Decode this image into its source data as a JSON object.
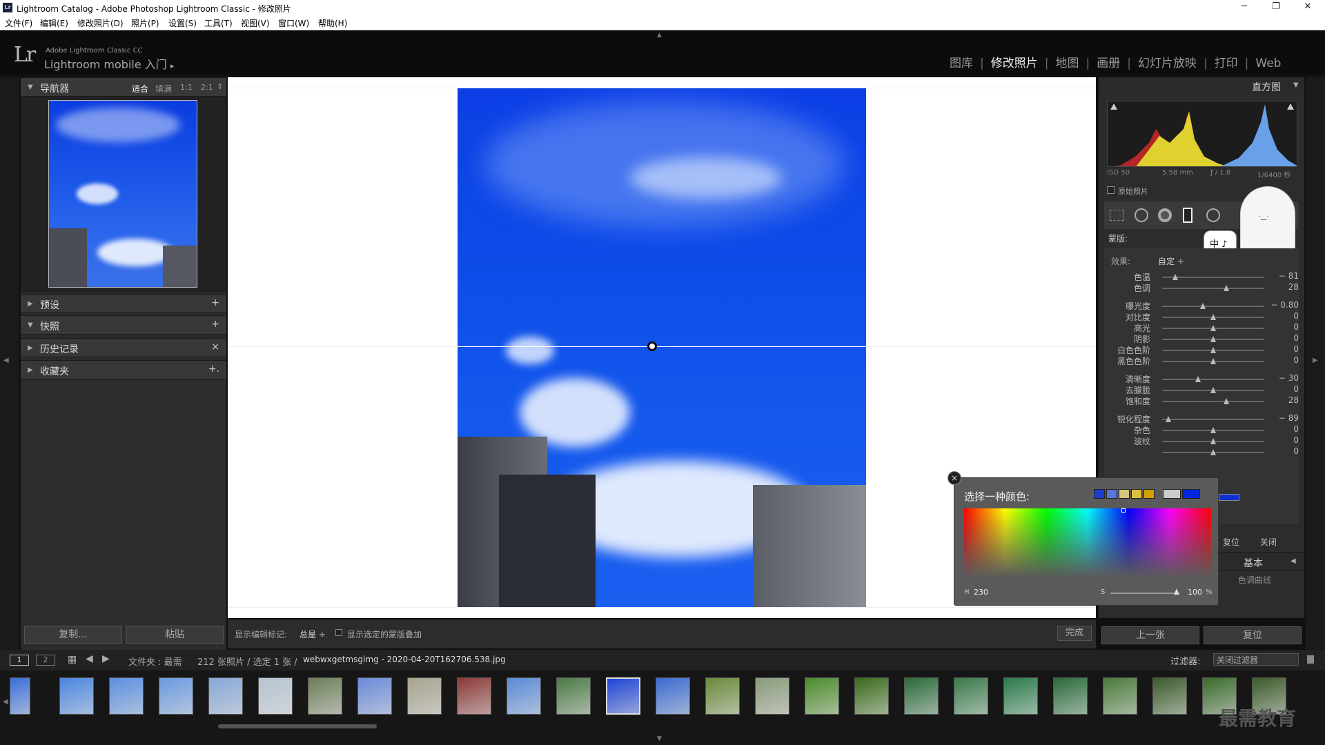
{
  "window": {
    "title": "Lightroom Catalog - Adobe Photoshop Lightroom Classic - 修改照片",
    "app_icon": "Lr",
    "minimize": "─",
    "maximize": "❐",
    "close": "✕"
  },
  "menu": [
    "文件(F)",
    "编辑(E)",
    "修改照片(D)",
    "照片(P)",
    "设置(S)",
    "工具(T)",
    "视图(V)",
    "窗口(W)",
    "帮助(H)"
  ],
  "identity": {
    "logo": "Lr",
    "small": "Adobe Lightroom Classic CC",
    "big": "Lightroom mobile 入门",
    "arrow": "▸"
  },
  "modules": [
    {
      "label": "图库",
      "active": false
    },
    {
      "label": "修改照片",
      "active": true
    },
    {
      "label": "地图",
      "active": false
    },
    {
      "label": "画册",
      "active": false
    },
    {
      "label": "幻灯片放映",
      "active": false
    },
    {
      "label": "打印",
      "active": false
    },
    {
      "label": "Web",
      "active": false
    }
  ],
  "navigator": {
    "title": "导航器",
    "fit": "适合",
    "fill": "填满",
    "one": "1:1",
    "two": "2:1",
    "arrows": "⇕"
  },
  "left_panels": [
    {
      "label": "预设",
      "end": "+",
      "expanded": false
    },
    {
      "label": "快照",
      "end": "+",
      "expanded": true
    },
    {
      "label": "历史记录",
      "end": "×",
      "expanded": false
    },
    {
      "label": "收藏夹",
      "end": "+.",
      "expanded": false
    }
  ],
  "left_buttons": {
    "copy": "复制...",
    "paste": "粘贴"
  },
  "histogram": {
    "title": "直方图",
    "iso": "ISO 50",
    "focal": "5.58 mm",
    "aperture": "ƒ / 1.8",
    "shutter": "1/6400 秒",
    "original": "原始照片"
  },
  "mask": {
    "label": "蒙版:",
    "effect_label": "效果:",
    "effect_value": "自定 ÷"
  },
  "sliders": [
    {
      "name": "色温",
      "value": "− 81",
      "pos": 0.13
    },
    {
      "name": "色调",
      "value": "28",
      "pos": 0.63
    },
    {
      "name": "曝光度",
      "value": "− 0.80",
      "pos": 0.4
    },
    {
      "name": "对比度",
      "value": "0",
      "pos": 0.5
    },
    {
      "name": "高光",
      "value": "0",
      "pos": 0.5
    },
    {
      "name": "阴影",
      "value": "0",
      "pos": 0.5
    },
    {
      "name": "白色色阶",
      "value": "0",
      "pos": 0.5
    },
    {
      "name": "黑色色阶",
      "value": "0",
      "pos": 0.5
    },
    {
      "name": "清晰度",
      "value": "− 30",
      "pos": 0.35
    },
    {
      "name": "去朦胧",
      "value": "0",
      "pos": 0.5
    },
    {
      "name": "饱和度",
      "value": "28",
      "pos": 0.63
    },
    {
      "name": "锐化程度",
      "value": "− 89",
      "pos": 0.06
    },
    {
      "name": "杂色",
      "value": "0",
      "pos": 0.5
    },
    {
      "name": "波纹",
      "value": "0",
      "pos": 0.5
    },
    {
      "name": "",
      "value": "0",
      "pos": 0.5
    }
  ],
  "color_picker": {
    "title": "选择一种颜色:",
    "h_label": "H",
    "h_value": "230",
    "s_label": "S",
    "s_value": "100",
    "percent": "%",
    "close": "×",
    "swatches": [
      "#1a3fd0",
      "#5a76d8",
      "#d8c77a",
      "#e0c040",
      "#d4a000"
    ],
    "big_swatches": [
      "#cccccc",
      "#0026e0"
    ]
  },
  "right_bottom": {
    "reset": "复位",
    "close": "关闭",
    "basic": "基本",
    "tone_curve": "色调曲线",
    "prev": "上一张",
    "reset_btn": "复位"
  },
  "toolbar": {
    "show_edit": "显示编辑标记:",
    "always": "总是 ÷",
    "overlay": "显示选定的蒙版叠加",
    "done": "完成"
  },
  "filmstrip_bar": {
    "p1": "1",
    "p2": "2",
    "folder": "文件夹 : 最需",
    "count": "212 张照片 / 选定 1 张 /",
    "filename": "webwxgetmsgimg - 2020-04-20T162706.538.jpg",
    "filter_label": "过滤器:",
    "filter_value": "关闭过滤器"
  },
  "watermark": "最需教育",
  "popup_cat": {
    "text": "中 ♪"
  },
  "thumbnails": [
    "#3a6fd8",
    "#4a86e0",
    "#5a8ee0",
    "#6a9ae0",
    "#86a8d8",
    "#b7c4d0",
    "#6d7e5a",
    "#6a8ad8",
    "#a6a38e",
    "#8a3a38",
    "#5a8ad8",
    "#4c7a46",
    "#1e44d6",
    "#3a6ad0",
    "#6a8a3a",
    "#8a9a7a",
    "#4a8a2a",
    "#3a6a1a",
    "#2a6a3a",
    "#3a7a4a",
    "#2a7a4a",
    "#2a6a3a",
    "#4a7a3a",
    "#3a5a2a",
    "#3a6a2a",
    "#3a5a2a"
  ]
}
